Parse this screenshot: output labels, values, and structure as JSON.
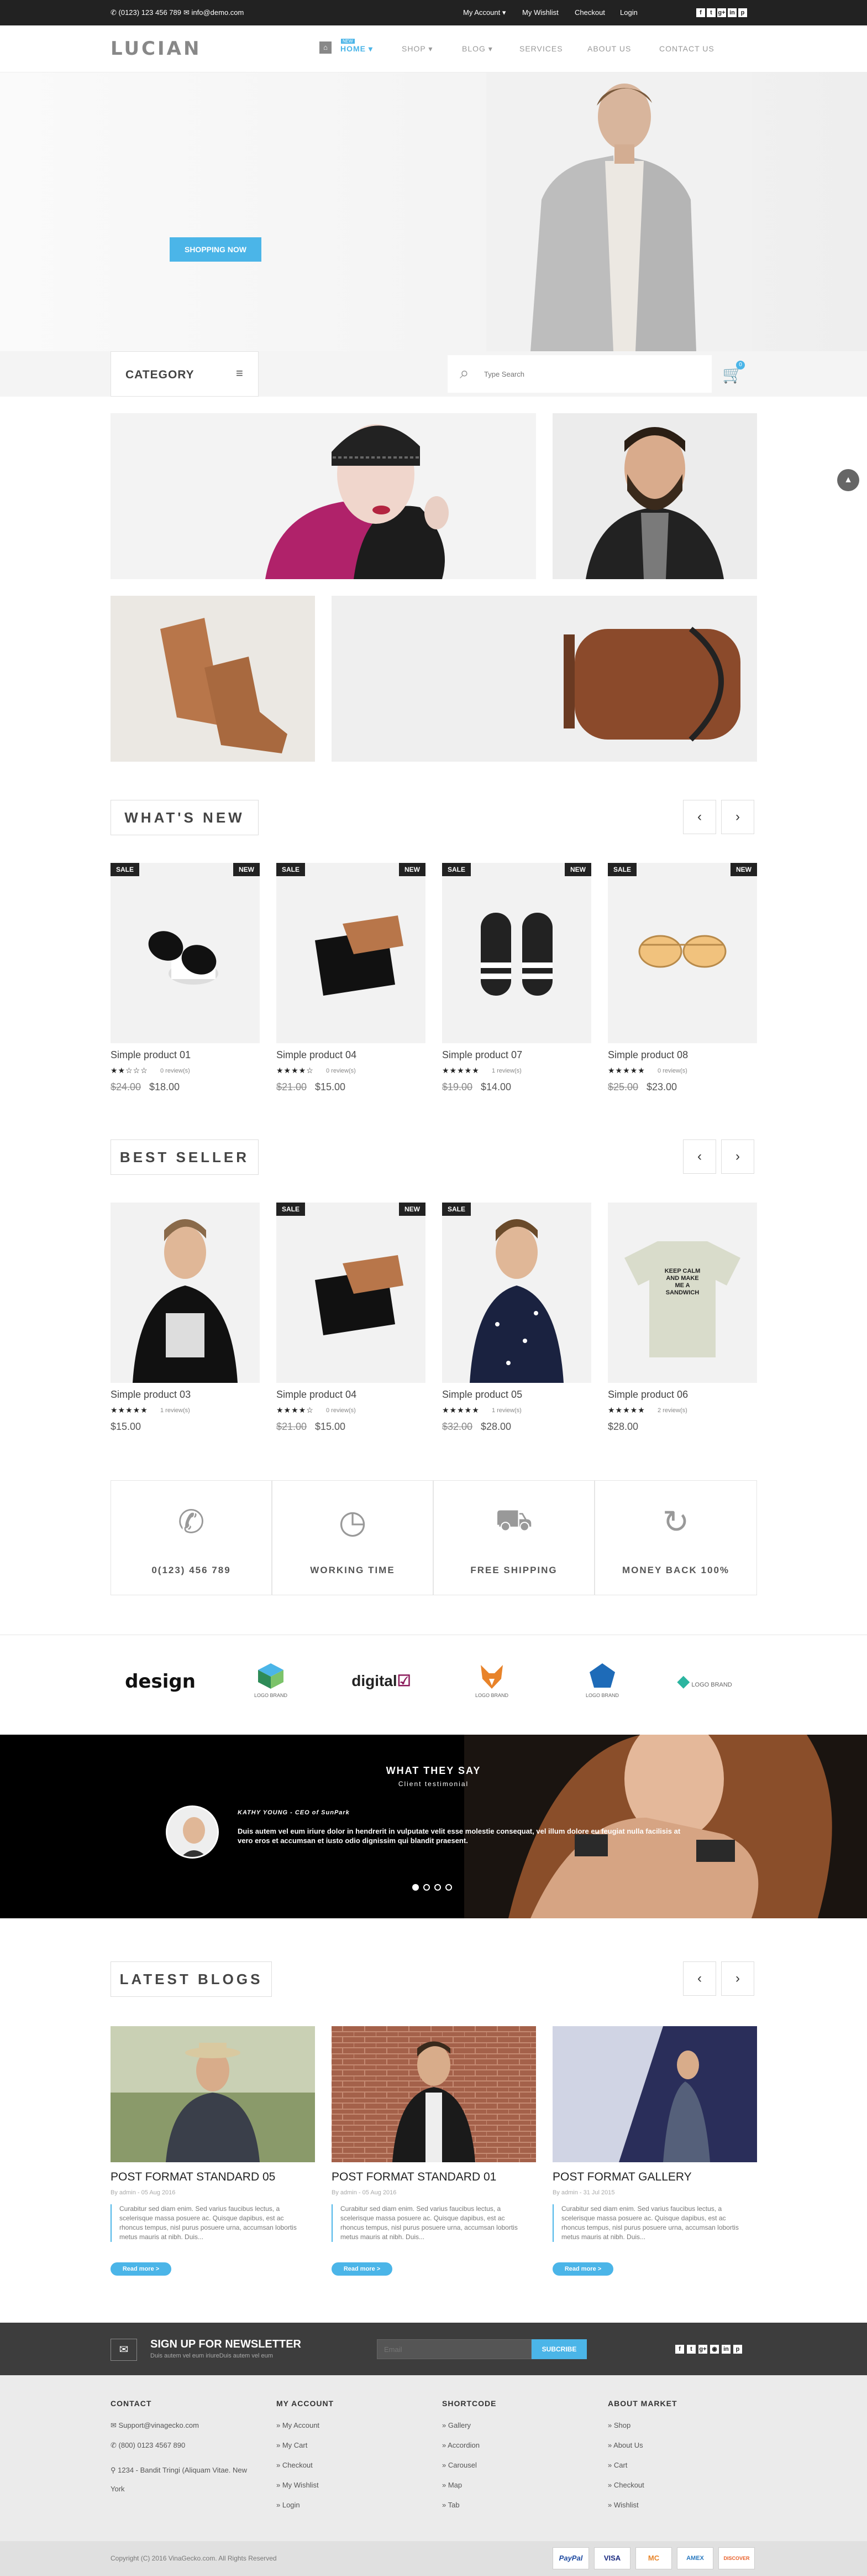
{
  "topbar": {
    "phone": "(0123) 123 456 789",
    "email": "info@demo.com",
    "links": [
      "My Account",
      "My Wishlist",
      "Checkout",
      "Login"
    ],
    "social": [
      "f",
      "t",
      "g+",
      "in",
      "p"
    ]
  },
  "header": {
    "logo": "LUCIAN",
    "nav": [
      "HOME",
      "SHOP",
      "BLOG",
      "SERVICES",
      "ABOUT US",
      "CONTACT US"
    ],
    "home_tag": "NEW"
  },
  "hero": {
    "button": "SHOPPING NOW"
  },
  "catbar": {
    "category": "CATEGORY",
    "search_placeholder": "Type Search",
    "cart_count": "0"
  },
  "sections": {
    "whats_new": "WHAT'S NEW",
    "best_seller": "BEST SELLER",
    "latest_blogs": "LATEST BLOGS"
  },
  "whats_new": [
    {
      "name": "Simple product 01",
      "reviews": "0 review(s)",
      "old": "$24.00",
      "price": "$18.00",
      "sale": "SALE",
      "new": "NEW",
      "rating": 2
    },
    {
      "name": "Simple product 04",
      "reviews": "0 review(s)",
      "old": "$21.00",
      "price": "$15.00",
      "sale": "SALE",
      "new": "NEW",
      "rating": 4
    },
    {
      "name": "Simple product 07",
      "reviews": "1 review(s)",
      "old": "$19.00",
      "price": "$14.00",
      "sale": "SALE",
      "new": "NEW",
      "rating": 5
    },
    {
      "name": "Simple product 08",
      "reviews": "0 review(s)",
      "old": "$25.00",
      "price": "$23.00",
      "sale": "SALE",
      "new": "NEW",
      "rating": 5
    }
  ],
  "best_seller": [
    {
      "name": "Simple product 03",
      "reviews": "1 review(s)",
      "old": "",
      "price": "$15.00",
      "sale": "",
      "new": "",
      "rating": 5
    },
    {
      "name": "Simple product 04",
      "reviews": "0 review(s)",
      "old": "$21.00",
      "price": "$15.00",
      "sale": "SALE",
      "new": "NEW",
      "rating": 4
    },
    {
      "name": "Simple product 05",
      "reviews": "1 review(s)",
      "old": "$32.00",
      "price": "$28.00",
      "sale": "SALE",
      "new": "",
      "rating": 5
    },
    {
      "name": "Simple product 06",
      "reviews": "2 review(s)",
      "old": "",
      "price": "$28.00",
      "sale": "",
      "new": "",
      "rating": 5
    }
  ],
  "tshirt_text": "KEEP CALM AND MAKE ME A SANDWICH",
  "features": [
    "0(123) 456 789",
    "WORKING TIME",
    "FREE SHIPPING",
    "MONEY BACK 100%"
  ],
  "brands": [
    "design",
    "LOGO BRAND",
    "digital",
    "LOGO BRAND",
    "LOGO BRAND",
    "LOGO BRAND"
  ],
  "testimonial": {
    "heading": "WHAT THEY SAY",
    "sub": "Client testimonial",
    "author": "KATHY YOUNG - CEO of SunPark",
    "quote": "Duis autem vel eum iriure dolor in hendrerit in vulputate velit esse molestie consequat, vel illum dolore eu feugiat nulla facilisis at vero eros et accumsan et iusto odio dignissim qui blandit praesent."
  },
  "blogs": [
    {
      "title": "POST FORMAT STANDARD 05",
      "meta": "By admin - 05 Aug 2016",
      "text": "Curabitur sed diam enim. Sed varius faucibus lectus, a scelerisque massa posuere ac. Quisque dapibus, est ac rhoncus tempus, nisl purus posuere urna, accumsan lobortis metus mauris at nibh. Duis..."
    },
    {
      "title": "POST FORMAT STANDARD 01",
      "meta": "By admin - 05 Aug 2016",
      "text": "Curabitur sed diam enim. Sed varius faucibus lectus, a scelerisque massa posuere ac. Quisque dapibus, est ac rhoncus tempus, nisl purus posuere urna, accumsan lobortis metus mauris at nibh. Duis..."
    },
    {
      "title": "POST FORMAT GALLERY",
      "meta": "By admin - 31 Jul 2015",
      "text": "Curabitur sed diam enim. Sed varius faucibus lectus, a scelerisque massa posuere ac. Quisque dapibus, est ac rhoncus tempus, nisl purus posuere urna, accumsan lobortis metus mauris at nibh. Duis..."
    }
  ],
  "read_more": "Read more >",
  "newsletter": {
    "title": "SIGN UP FOR NEWSLETTER",
    "sub": "Duis autem vel eum iriureDuis autem vel eum",
    "placeholder": "Email",
    "button": "SUBCRIBE"
  },
  "footer": {
    "contact": {
      "title": "CONTACT",
      "items": [
        "Support@vinagecko.com",
        "(800) 0123 4567 890",
        "1234 - Bandit Tringi (Aliquam Vitae. New York"
      ]
    },
    "account": {
      "title": "MY ACCOUNT",
      "items": [
        "My Account",
        "My Cart",
        "Checkout",
        "My Wishlist",
        "Login"
      ]
    },
    "shortcode": {
      "title": "SHORTCODE",
      "items": [
        "Gallery",
        "Accordion",
        "Carousel",
        "Map",
        "Tab"
      ]
    },
    "about": {
      "title": "ABOUT MARKET",
      "items": [
        "Shop",
        "About Us",
        "Cart",
        "Checkout",
        "Wishlist"
      ]
    }
  },
  "copyright": "Copyright (C) 2016 VinaGecko.com. All Rights Reserved",
  "payments": [
    "PayPal",
    "VISA",
    "MC",
    "AMEX",
    "DISCOVER"
  ],
  "colors": {
    "accent": "#4bb5e8",
    "dark": "#222222"
  }
}
